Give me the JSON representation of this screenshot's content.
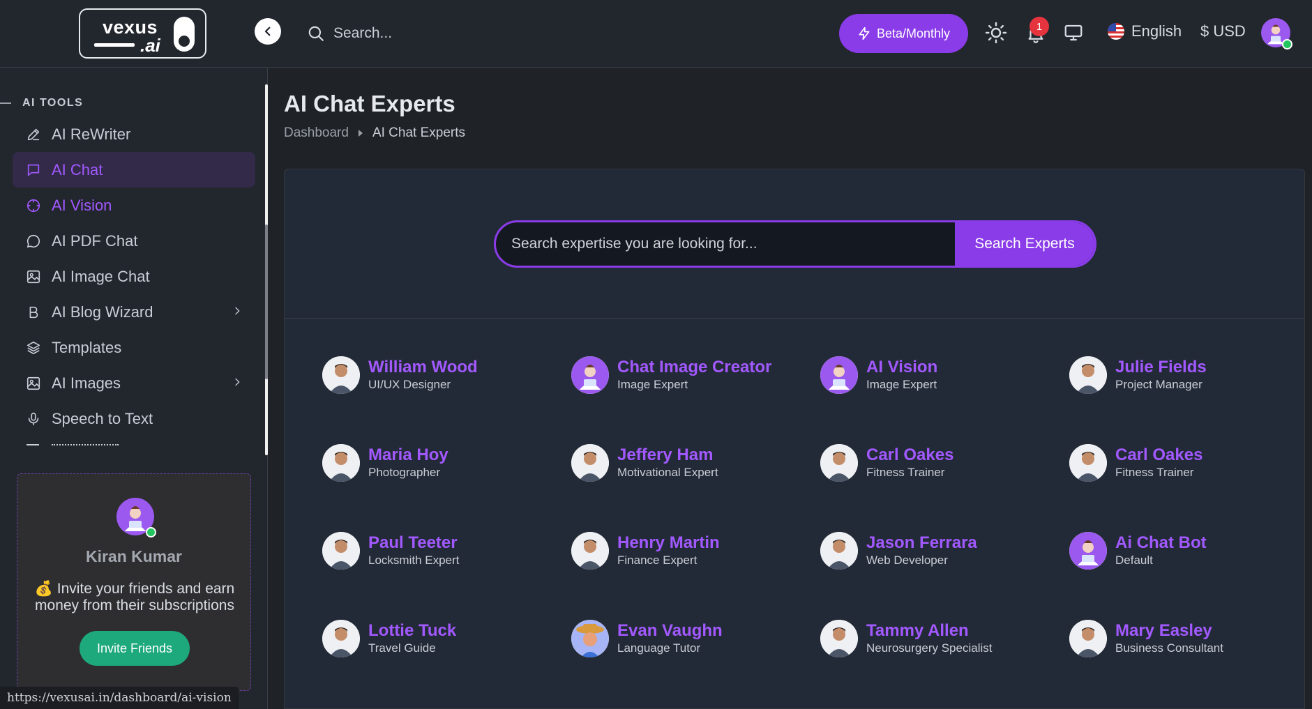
{
  "header": {
    "logo_word": "vexus",
    "logo_sub": ".ai",
    "search_placeholder": "Search...",
    "plan_label": "Beta/Monthly",
    "notifications_count": "1",
    "language": "English",
    "currency": "$ USD"
  },
  "sidebar": {
    "section_title": "AI TOOLS",
    "items": [
      {
        "label": "AI ReWriter",
        "icon": "pencil-icon"
      },
      {
        "label": "AI Chat",
        "icon": "chat-square-icon",
        "active": true
      },
      {
        "label": "AI Vision",
        "icon": "crosshair-icon"
      },
      {
        "label": "AI PDF Chat",
        "icon": "chat-bubble-icon"
      },
      {
        "label": "AI Image Chat",
        "icon": "image-icon"
      },
      {
        "label": "AI Blog Wizard",
        "icon": "bold-b-icon",
        "has_children": true
      },
      {
        "label": "Templates",
        "icon": "layers-icon"
      },
      {
        "label": "AI Images",
        "icon": "image-icon",
        "has_children": true
      },
      {
        "label": "Speech to Text",
        "icon": "microphone-icon"
      }
    ],
    "invite": {
      "user_name": "Kiran Kumar",
      "text": "💰 Invite your friends and earn money from their subscriptions",
      "button_label": "Invite Friends"
    }
  },
  "status_bar": {
    "url": "https://vexusai.in/dashboard/ai-vision"
  },
  "main": {
    "title": "AI Chat Experts",
    "breadcrumb": {
      "home": "Dashboard",
      "current": "AI Chat Experts"
    },
    "search_placeholder": "Search expertise you are looking for...",
    "search_button": "Search Experts",
    "experts": [
      {
        "name": "William Wood",
        "role": "UI/UX Designer",
        "avatar": "person-avatar"
      },
      {
        "name": "Chat Image Creator",
        "role": "Image Expert",
        "avatar": "bot-avatar"
      },
      {
        "name": "AI Vision",
        "role": "Image Expert",
        "avatar": "bot-avatar"
      },
      {
        "name": "Julie Fields",
        "role": "Project Manager",
        "avatar": "person-avatar"
      },
      {
        "name": "Maria Hoy",
        "role": "Photographer",
        "avatar": "person-avatar"
      },
      {
        "name": "Jeffery Ham",
        "role": "Motivational Expert",
        "avatar": "person-avatar"
      },
      {
        "name": "Carl Oakes",
        "role": "Fitness Trainer",
        "avatar": "person-avatar"
      },
      {
        "name": "Carl Oakes",
        "role": "Fitness Trainer",
        "avatar": "person-avatar"
      },
      {
        "name": "Paul Teeter",
        "role": "Locksmith Expert",
        "avatar": "person-avatar"
      },
      {
        "name": "Henry Martin",
        "role": "Finance Expert",
        "avatar": "person-avatar"
      },
      {
        "name": "Jason Ferrara",
        "role": "Web Developer",
        "avatar": "person-avatar"
      },
      {
        "name": "Ai Chat Bot",
        "role": "Default",
        "avatar": "bot-avatar"
      },
      {
        "name": "Lottie Tuck",
        "role": "Travel Guide",
        "avatar": "person-avatar"
      },
      {
        "name": "Evan Vaughn",
        "role": "Language Tutor",
        "avatar": "cartoon-avatar"
      },
      {
        "name": "Tammy Allen",
        "role": "Neurosurgery Specialist",
        "avatar": "person-avatar"
      },
      {
        "name": "Mary Easley",
        "role": "Business Consultant",
        "avatar": "person-avatar"
      }
    ]
  },
  "colors": {
    "accent": "#8b3ce9",
    "accent_text": "#a259ff",
    "invite_button": "#1ea97c",
    "badge": "#e5343d",
    "background": "#1f2227",
    "card": "#232a37"
  }
}
